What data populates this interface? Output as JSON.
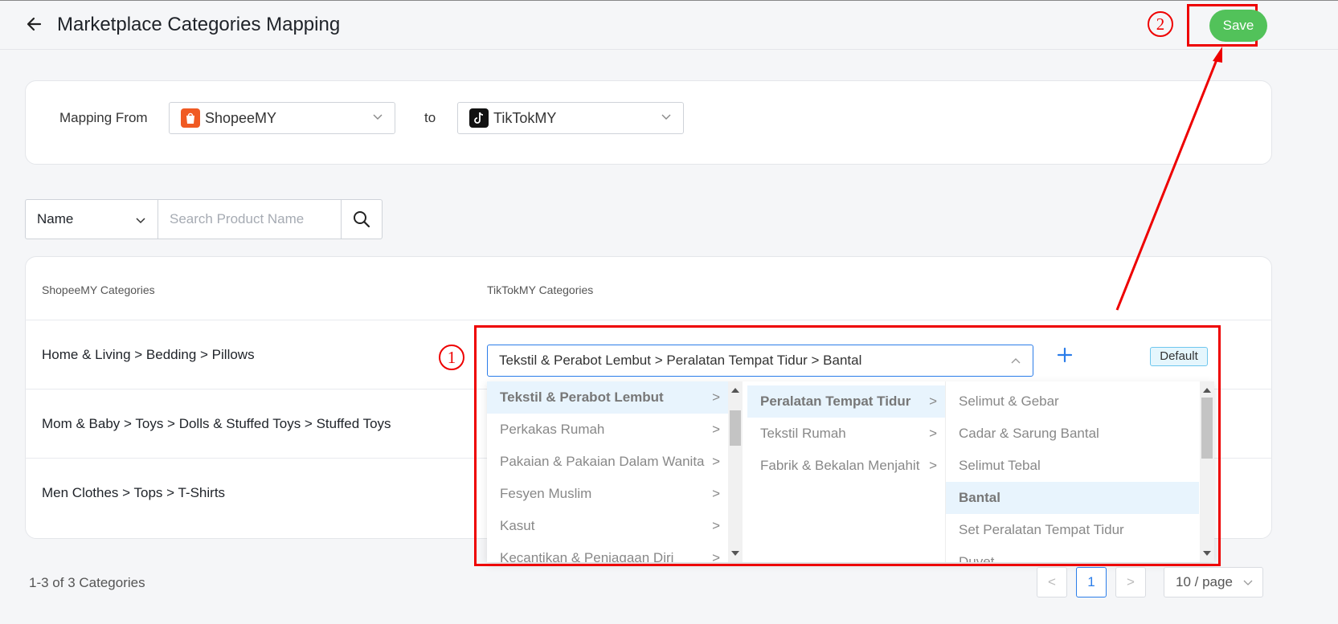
{
  "header": {
    "title": "Marketplace Categories Mapping",
    "save_label": "Save"
  },
  "annotations": {
    "step1": "1",
    "step2": "2"
  },
  "mapping": {
    "from_label": "Mapping From",
    "from_value": "ShopeeMY",
    "to_label": "to",
    "to_value": "TikTokMY"
  },
  "search": {
    "field_value": "Name",
    "placeholder": "Search Product Name"
  },
  "table": {
    "headers": [
      "ShopeeMY Categories",
      "TikTokMY Categories"
    ],
    "rows": [
      {
        "source": "Home & Living > Bedding > Pillows",
        "target": "Tekstil & Perabot Lembut > Peralatan Tempat Tidur > Bantal",
        "badge": "Default"
      },
      {
        "source": "Mom & Baby > Toys > Dolls & Stuffed Toys > Stuffed Toys"
      },
      {
        "source": "Men Clothes > Tops > T-Shirts"
      }
    ]
  },
  "cascader": {
    "col1": [
      "Tekstil & Perabot Lembut",
      "Perkakas Rumah",
      "Pakaian & Pakaian Dalam Wanita",
      "Fesyen Muslim",
      "Kasut",
      "Kecantikan & Penjagaan Diri"
    ],
    "col2": [
      "Peralatan Tempat Tidur",
      "Tekstil Rumah",
      "Fabrik & Bekalan Menjahit"
    ],
    "col3": [
      "Selimut & Gebar",
      "Cadar & Sarung Bantal",
      "Selimut Tebal",
      "Bantal",
      "Set Peralatan Tempat Tidur",
      "Duvet"
    ],
    "selected": [
      "Tekstil & Perabot Lembut",
      "Peralatan Tempat Tidur",
      "Bantal"
    ],
    "arrow": ">"
  },
  "pagination": {
    "info": "1-3 of 3 Categories",
    "current_page": "1",
    "prev": "<",
    "next": ">",
    "page_size": "10 / page"
  },
  "colors": {
    "accent": "#2b7de9",
    "save_green": "#52c25a",
    "annotation_red": "#ee0000",
    "active_option_bg": "#e8f4fd"
  }
}
